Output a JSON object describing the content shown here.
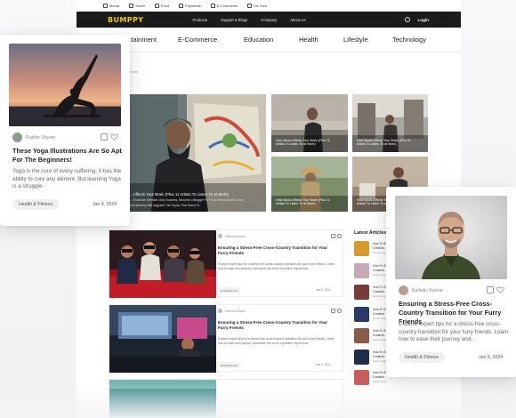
{
  "topbar": {
    "items": [
      "Media",
      "Travel",
      "Food",
      "Payments",
      "E-Commerce",
      "Ed-Tech"
    ]
  },
  "nav": {
    "logo": "BUMPPY",
    "links": [
      "Products",
      "Support & Blogs",
      "Company",
      "About Us"
    ],
    "login": "Login"
  },
  "categories": [
    "...tainment",
    "E-Commerce",
    "Education",
    "Health",
    "Lifestyle",
    "Technology"
  ],
  "breadcrumb": "...mple",
  "section_title": "e",
  "hero": {
    "caption": "...Affects Your Brain (Plus 11 Artists To Listen To at Work)",
    "caption2": "... Exclusive Member-Only Success, Become a Blogger For Your Shows Access. Your Membership Will Upgrade The Topics That Stand To"
  },
  "tiles": [
    {
      "caption": "How Music Affects Your Brain (Plus 11 Artists To Listen To at Work)"
    },
    {
      "caption": "How Music Affects Your Brain (Plus 11 Artists To Listen To at Work)"
    },
    {
      "caption": "How Music Affects Your Brain (Plus 11 Artists To Listen To at Work)"
    },
    {
      "caption": "How Music Affects Your Brain (Plus 11 Artists To Listen To at Work)"
    }
  ],
  "feed": [
    {
      "author": "Editorial Name",
      "title": "Ensuring a Stress-Free Cross-Country Transition for Your Furry Friends",
      "excerpt": "Explore expert tips for a stress-free cross-country transition for your furry friends. Learn how to ease their journey and make the move a positive experience.",
      "tag": "Entertainment",
      "date": "Jan 9, 2024"
    },
    {
      "author": "Editorial Name",
      "title": "Ensuring a Stress-Free Cross-Country Transition for Your Furry Friends",
      "excerpt": "Explore expert tips for a stress-free cross-country transition for your furry friends. Learn how to ease their journey and make the move a positive experience.",
      "tag": "Entertainment",
      "date": "Jan 9, 2024"
    }
  ],
  "latest": {
    "title": "Latest Articles",
    "items": [
      {
        "title": "How To St...",
        "sub": "Creativit...",
        "meta": "Harsh Dogr..."
      },
      {
        "title": "How To St...",
        "sub": "Creativit...",
        "meta": "Harsh Dogr..."
      },
      {
        "title": "How To St...",
        "sub": "Creativit...",
        "meta": "Harsh Dogr..."
      },
      {
        "title": "How To St...",
        "sub": "Creativit...",
        "meta": "Harsh Dogr..."
      },
      {
        "title": "How To St...",
        "sub": "Creativit...",
        "meta": "Harsh Dogr..."
      },
      {
        "title": "How To St...",
        "sub": "Creativit...",
        "meta": "Harsh Dogr..."
      },
      {
        "title": "How To St...",
        "sub": "Creativit...",
        "meta": "Harsh Dogr..."
      },
      {
        "title": "How To St...",
        "sub": "Creativit...",
        "meta": "Harsh Dogr..."
      }
    ]
  },
  "card_left": {
    "author": "Radhe Shyam",
    "title": "These Yoga Illustrations Are So Apt For The Beginners!",
    "excerpt": "Yoga is the cure of every suffering. It has the ability to cure any ailment. But learning Yoga is a struggle.",
    "tag": "Health & Fitness",
    "date": "Jan 9, 2024"
  },
  "card_right": {
    "author": "Ballistic Kumar",
    "title": "Ensuring a Stress-Free Cross-Country Transition for Your Furry Friends",
    "excerpt": "Explore expert tips for a stress-free cross-country transition for your furry friends. Learn how to ease their journey and...",
    "tag": "Health & Fitness",
    "date": "Jan 9, 2024"
  },
  "colors": {
    "brand_yellow": "#f5c400",
    "nav_dark": "#1b1b1b",
    "card_bg": "#ffffff",
    "tag_bg": "#f0f0f2"
  },
  "icons": [
    "search-icon",
    "save-icon",
    "heart-icon"
  ]
}
